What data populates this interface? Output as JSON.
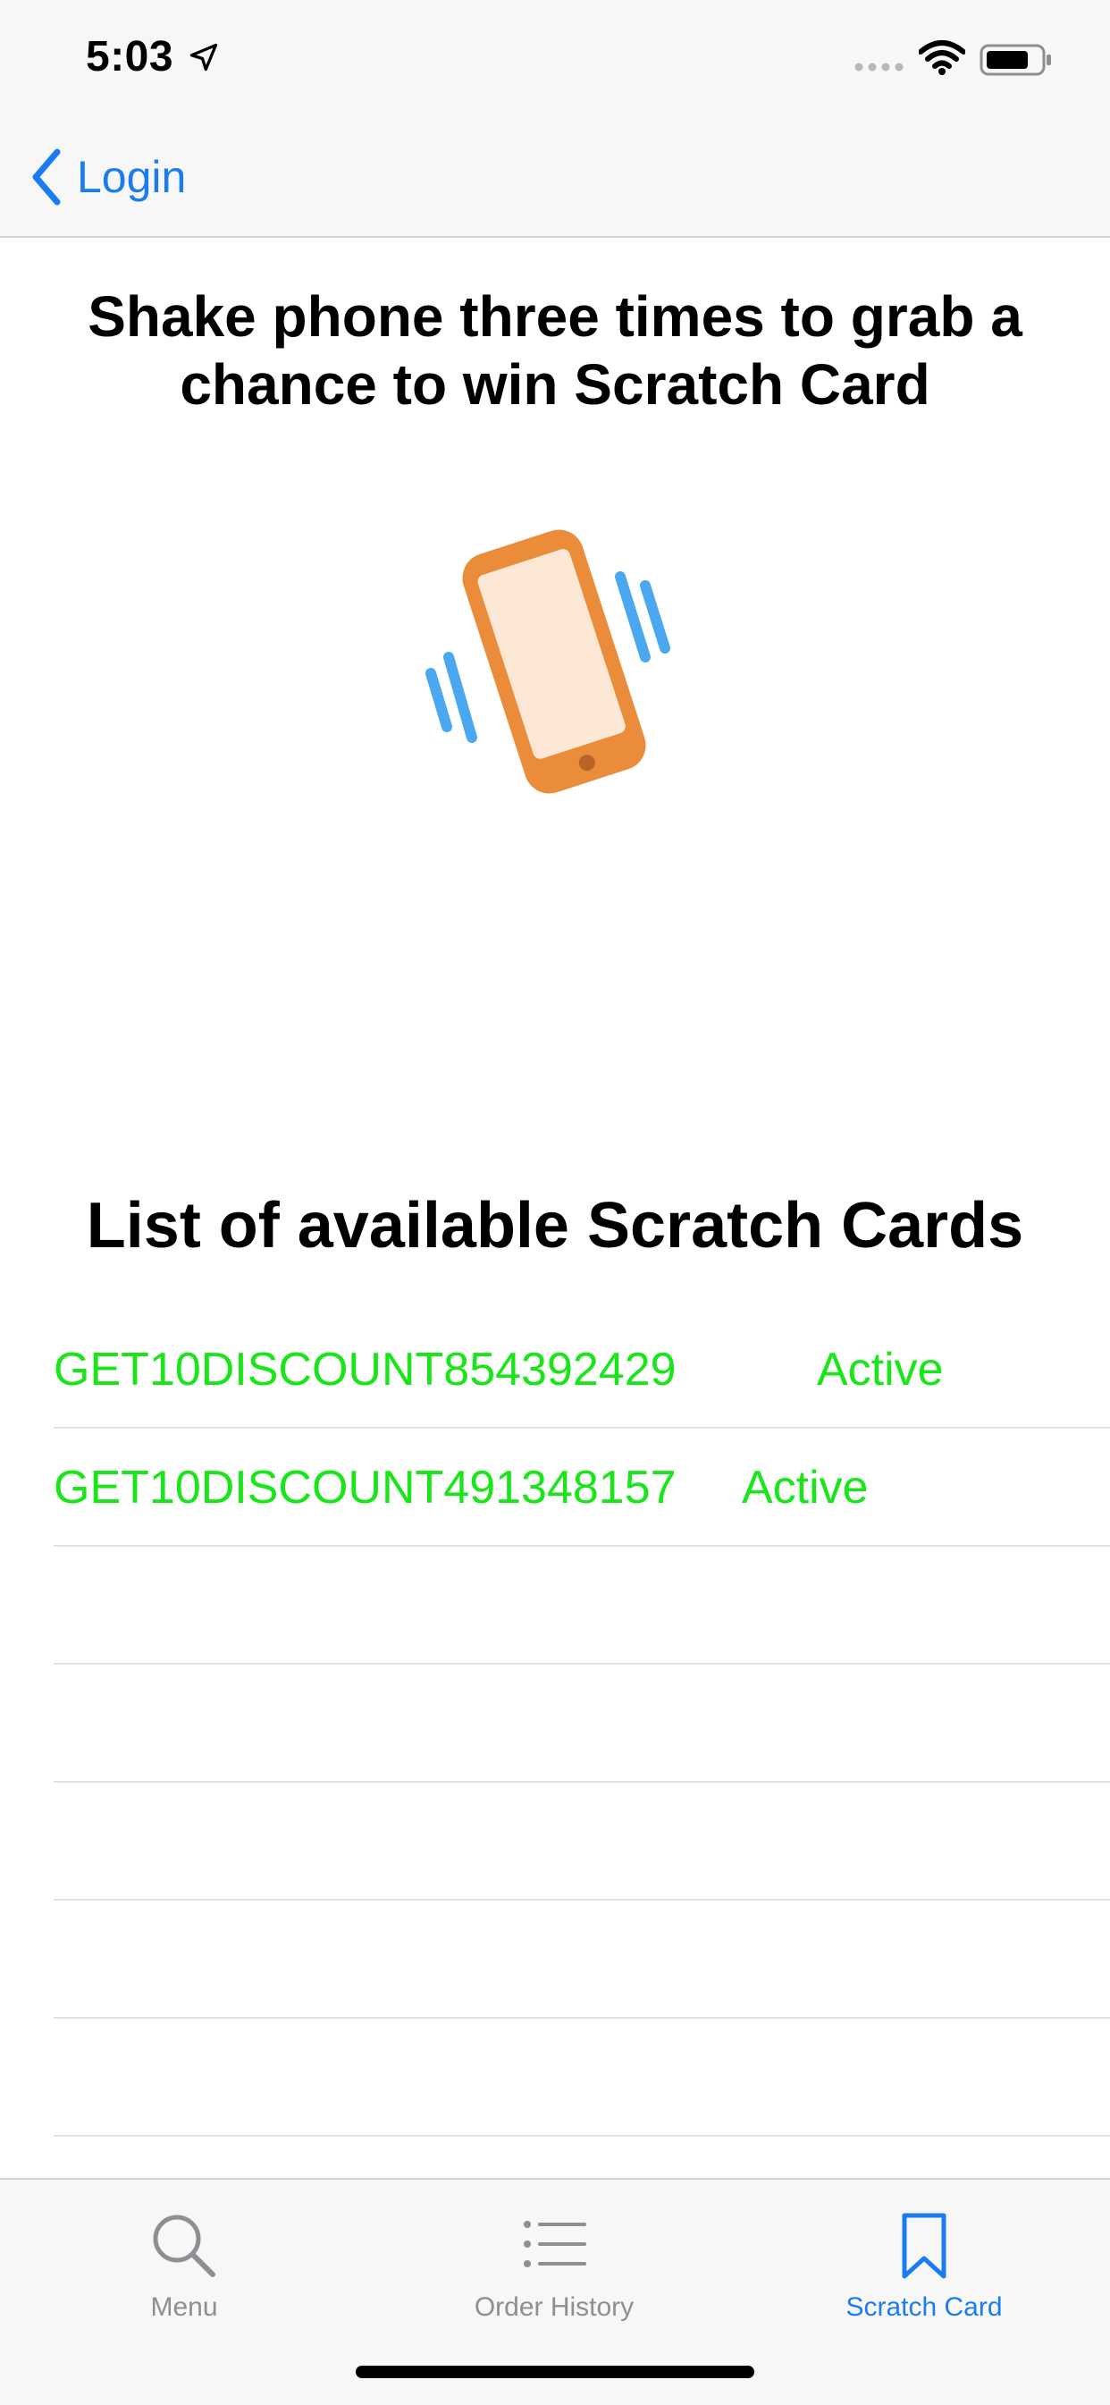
{
  "status_bar": {
    "time": "5:03",
    "icons": [
      "location-arrow-icon",
      "signal-dots-icon",
      "wifi-icon",
      "battery-icon"
    ]
  },
  "nav": {
    "back_label": "Login",
    "back_icon": "chevron-left-icon",
    "accent_color": "#1a7cf0"
  },
  "headline": "Shake phone three times to grab a chance to win Scratch Card",
  "shake_icon": "shaking-phone-icon",
  "list": {
    "title": "List of available Scratch Cards",
    "items": [
      {
        "code": "GET10DISCOUNT854392429",
        "status": "Active"
      },
      {
        "code": "GET10DISCOUNT491348157",
        "status": "Active"
      }
    ],
    "status_color": "#19e619"
  },
  "tabs": [
    {
      "label": "Menu",
      "icon": "search-icon",
      "active": false
    },
    {
      "label": "Order History",
      "icon": "list-icon",
      "active": false
    },
    {
      "label": "Scratch Card",
      "icon": "bookmark-icon",
      "active": true
    }
  ]
}
